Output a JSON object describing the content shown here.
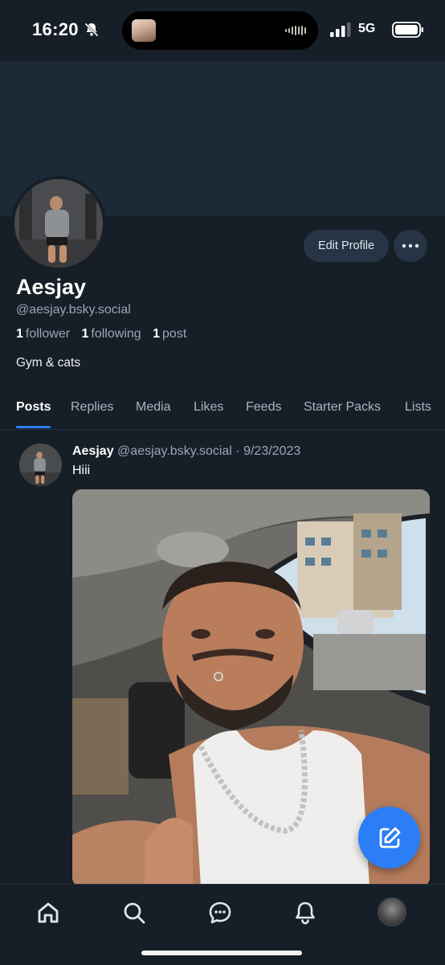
{
  "status_bar": {
    "time": "16:20",
    "network": "5G",
    "icons": [
      "bell-slash-icon",
      "signal-icon",
      "battery-icon"
    ]
  },
  "profile": {
    "display_name": "Aesjay",
    "handle": "@aesjay.bsky.social",
    "followers_count": "1",
    "followers_label": "follower",
    "following_count": "1",
    "following_label": "following",
    "posts_count": "1",
    "posts_label": "post",
    "bio": "Gym & cats",
    "edit_button": "Edit Profile",
    "more_icon": "ellipsis-icon"
  },
  "tabs": [
    {
      "label": "Posts",
      "active": true
    },
    {
      "label": "Replies",
      "active": false
    },
    {
      "label": "Media",
      "active": false
    },
    {
      "label": "Likes",
      "active": false
    },
    {
      "label": "Feeds",
      "active": false
    },
    {
      "label": "Starter Packs",
      "active": false
    },
    {
      "label": "Lists",
      "active": false
    }
  ],
  "post": {
    "author": "Aesjay",
    "meta": "@aesjay.bsky.social · 9/23/2023",
    "text": "Hiii"
  },
  "fab_icon": "compose-icon",
  "bottom_nav": [
    "home-icon",
    "search-icon",
    "chat-icon",
    "bell-icon",
    "profile-avatar"
  ],
  "colors": {
    "accent": "#2b7ef5",
    "background": "#161e27",
    "banner": "#1c2a38"
  }
}
